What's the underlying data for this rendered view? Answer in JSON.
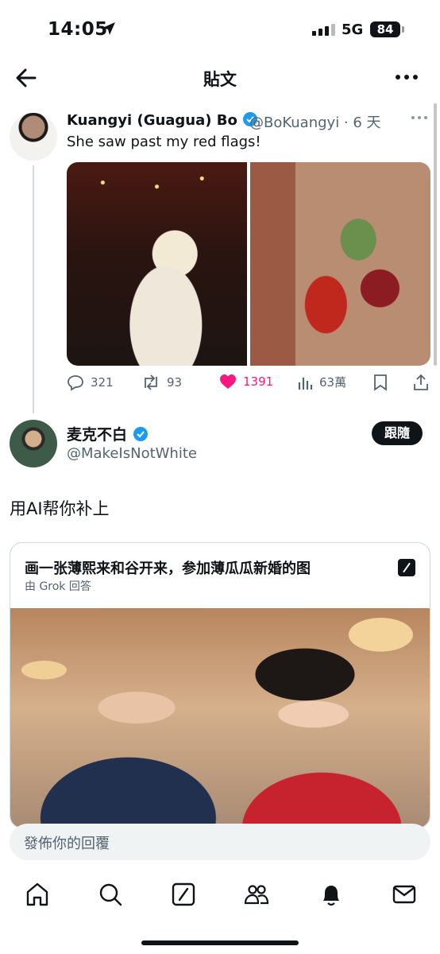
{
  "status": {
    "time": "14:05",
    "network": "5G",
    "battery": "84"
  },
  "header": {
    "title": "貼文"
  },
  "quoted": {
    "name": "Kuangyi (Guagua) Bo",
    "handle_time": "@BoKuangyi · 6 天",
    "text": "She saw past my red flags!",
    "stats": {
      "replies": "321",
      "retweets": "93",
      "likes": "1391",
      "views": "63萬"
    }
  },
  "post": {
    "name": "麦克不白",
    "handle": "@MakeIsNotWhite",
    "follow_label": "跟隨",
    "text": "用AI帮你补上"
  },
  "grok": {
    "prompt": "画一张薄熙来和谷开来，参加薄瓜瓜新婚的图",
    "sub": "由 Grok 回答"
  },
  "reply": {
    "placeholder": "發佈你的回覆"
  },
  "colors": {
    "like": "#f91880",
    "verified": "#1d9bf0",
    "text": "#0f1419",
    "muted": "#536471"
  }
}
